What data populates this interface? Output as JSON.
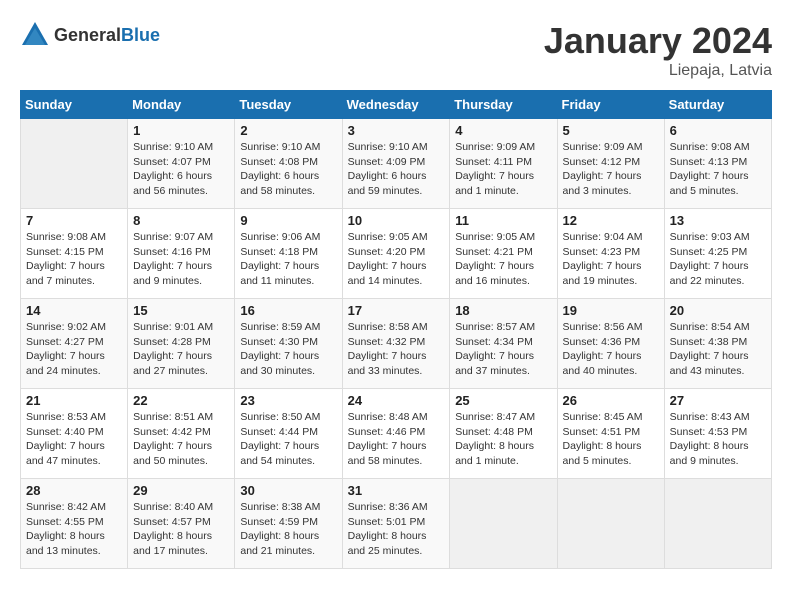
{
  "header": {
    "logo_general": "General",
    "logo_blue": "Blue",
    "month_title": "January 2024",
    "location": "Liepaja, Latvia"
  },
  "weekdays": [
    "Sunday",
    "Monday",
    "Tuesday",
    "Wednesday",
    "Thursday",
    "Friday",
    "Saturday"
  ],
  "weeks": [
    [
      {
        "day": "",
        "sunrise": "",
        "sunset": "",
        "daylight": ""
      },
      {
        "day": "1",
        "sunrise": "Sunrise: 9:10 AM",
        "sunset": "Sunset: 4:07 PM",
        "daylight": "Daylight: 6 hours and 56 minutes."
      },
      {
        "day": "2",
        "sunrise": "Sunrise: 9:10 AM",
        "sunset": "Sunset: 4:08 PM",
        "daylight": "Daylight: 6 hours and 58 minutes."
      },
      {
        "day": "3",
        "sunrise": "Sunrise: 9:10 AM",
        "sunset": "Sunset: 4:09 PM",
        "daylight": "Daylight: 6 hours and 59 minutes."
      },
      {
        "day": "4",
        "sunrise": "Sunrise: 9:09 AM",
        "sunset": "Sunset: 4:11 PM",
        "daylight": "Daylight: 7 hours and 1 minute."
      },
      {
        "day": "5",
        "sunrise": "Sunrise: 9:09 AM",
        "sunset": "Sunset: 4:12 PM",
        "daylight": "Daylight: 7 hours and 3 minutes."
      },
      {
        "day": "6",
        "sunrise": "Sunrise: 9:08 AM",
        "sunset": "Sunset: 4:13 PM",
        "daylight": "Daylight: 7 hours and 5 minutes."
      }
    ],
    [
      {
        "day": "7",
        "sunrise": "Sunrise: 9:08 AM",
        "sunset": "Sunset: 4:15 PM",
        "daylight": "Daylight: 7 hours and 7 minutes."
      },
      {
        "day": "8",
        "sunrise": "Sunrise: 9:07 AM",
        "sunset": "Sunset: 4:16 PM",
        "daylight": "Daylight: 7 hours and 9 minutes."
      },
      {
        "day": "9",
        "sunrise": "Sunrise: 9:06 AM",
        "sunset": "Sunset: 4:18 PM",
        "daylight": "Daylight: 7 hours and 11 minutes."
      },
      {
        "day": "10",
        "sunrise": "Sunrise: 9:05 AM",
        "sunset": "Sunset: 4:20 PM",
        "daylight": "Daylight: 7 hours and 14 minutes."
      },
      {
        "day": "11",
        "sunrise": "Sunrise: 9:05 AM",
        "sunset": "Sunset: 4:21 PM",
        "daylight": "Daylight: 7 hours and 16 minutes."
      },
      {
        "day": "12",
        "sunrise": "Sunrise: 9:04 AM",
        "sunset": "Sunset: 4:23 PM",
        "daylight": "Daylight: 7 hours and 19 minutes."
      },
      {
        "day": "13",
        "sunrise": "Sunrise: 9:03 AM",
        "sunset": "Sunset: 4:25 PM",
        "daylight": "Daylight: 7 hours and 22 minutes."
      }
    ],
    [
      {
        "day": "14",
        "sunrise": "Sunrise: 9:02 AM",
        "sunset": "Sunset: 4:27 PM",
        "daylight": "Daylight: 7 hours and 24 minutes."
      },
      {
        "day": "15",
        "sunrise": "Sunrise: 9:01 AM",
        "sunset": "Sunset: 4:28 PM",
        "daylight": "Daylight: 7 hours and 27 minutes."
      },
      {
        "day": "16",
        "sunrise": "Sunrise: 8:59 AM",
        "sunset": "Sunset: 4:30 PM",
        "daylight": "Daylight: 7 hours and 30 minutes."
      },
      {
        "day": "17",
        "sunrise": "Sunrise: 8:58 AM",
        "sunset": "Sunset: 4:32 PM",
        "daylight": "Daylight: 7 hours and 33 minutes."
      },
      {
        "day": "18",
        "sunrise": "Sunrise: 8:57 AM",
        "sunset": "Sunset: 4:34 PM",
        "daylight": "Daylight: 7 hours and 37 minutes."
      },
      {
        "day": "19",
        "sunrise": "Sunrise: 8:56 AM",
        "sunset": "Sunset: 4:36 PM",
        "daylight": "Daylight: 7 hours and 40 minutes."
      },
      {
        "day": "20",
        "sunrise": "Sunrise: 8:54 AM",
        "sunset": "Sunset: 4:38 PM",
        "daylight": "Daylight: 7 hours and 43 minutes."
      }
    ],
    [
      {
        "day": "21",
        "sunrise": "Sunrise: 8:53 AM",
        "sunset": "Sunset: 4:40 PM",
        "daylight": "Daylight: 7 hours and 47 minutes."
      },
      {
        "day": "22",
        "sunrise": "Sunrise: 8:51 AM",
        "sunset": "Sunset: 4:42 PM",
        "daylight": "Daylight: 7 hours and 50 minutes."
      },
      {
        "day": "23",
        "sunrise": "Sunrise: 8:50 AM",
        "sunset": "Sunset: 4:44 PM",
        "daylight": "Daylight: 7 hours and 54 minutes."
      },
      {
        "day": "24",
        "sunrise": "Sunrise: 8:48 AM",
        "sunset": "Sunset: 4:46 PM",
        "daylight": "Daylight: 7 hours and 58 minutes."
      },
      {
        "day": "25",
        "sunrise": "Sunrise: 8:47 AM",
        "sunset": "Sunset: 4:48 PM",
        "daylight": "Daylight: 8 hours and 1 minute."
      },
      {
        "day": "26",
        "sunrise": "Sunrise: 8:45 AM",
        "sunset": "Sunset: 4:51 PM",
        "daylight": "Daylight: 8 hours and 5 minutes."
      },
      {
        "day": "27",
        "sunrise": "Sunrise: 8:43 AM",
        "sunset": "Sunset: 4:53 PM",
        "daylight": "Daylight: 8 hours and 9 minutes."
      }
    ],
    [
      {
        "day": "28",
        "sunrise": "Sunrise: 8:42 AM",
        "sunset": "Sunset: 4:55 PM",
        "daylight": "Daylight: 8 hours and 13 minutes."
      },
      {
        "day": "29",
        "sunrise": "Sunrise: 8:40 AM",
        "sunset": "Sunset: 4:57 PM",
        "daylight": "Daylight: 8 hours and 17 minutes."
      },
      {
        "day": "30",
        "sunrise": "Sunrise: 8:38 AM",
        "sunset": "Sunset: 4:59 PM",
        "daylight": "Daylight: 8 hours and 21 minutes."
      },
      {
        "day": "31",
        "sunrise": "Sunrise: 8:36 AM",
        "sunset": "Sunset: 5:01 PM",
        "daylight": "Daylight: 8 hours and 25 minutes."
      },
      {
        "day": "",
        "sunrise": "",
        "sunset": "",
        "daylight": ""
      },
      {
        "day": "",
        "sunrise": "",
        "sunset": "",
        "daylight": ""
      },
      {
        "day": "",
        "sunrise": "",
        "sunset": "",
        "daylight": ""
      }
    ]
  ]
}
